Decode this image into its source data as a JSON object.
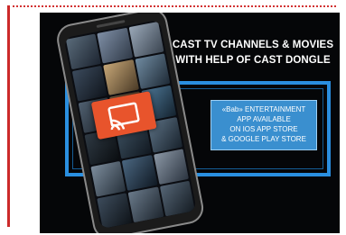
{
  "ad": {
    "headline_line1": "CAST TV CHANNELS & MOVIES",
    "headline_line2": "WITH HELP OF CAST DONGLE",
    "info_line1": "«Bab» ENTERTAINMENT",
    "info_line2": "APP AVAILABLE",
    "info_line3": "ON IOS APP STORE",
    "info_line4": "& GOOGLE PLAY STORE"
  },
  "colors": {
    "accent_red": "#cc2a2a",
    "frame_blue": "#2a8fe0",
    "info_blue": "#3a8fcf",
    "cast_orange": "#e8542c"
  },
  "icons": {
    "cast": "cast-icon"
  }
}
